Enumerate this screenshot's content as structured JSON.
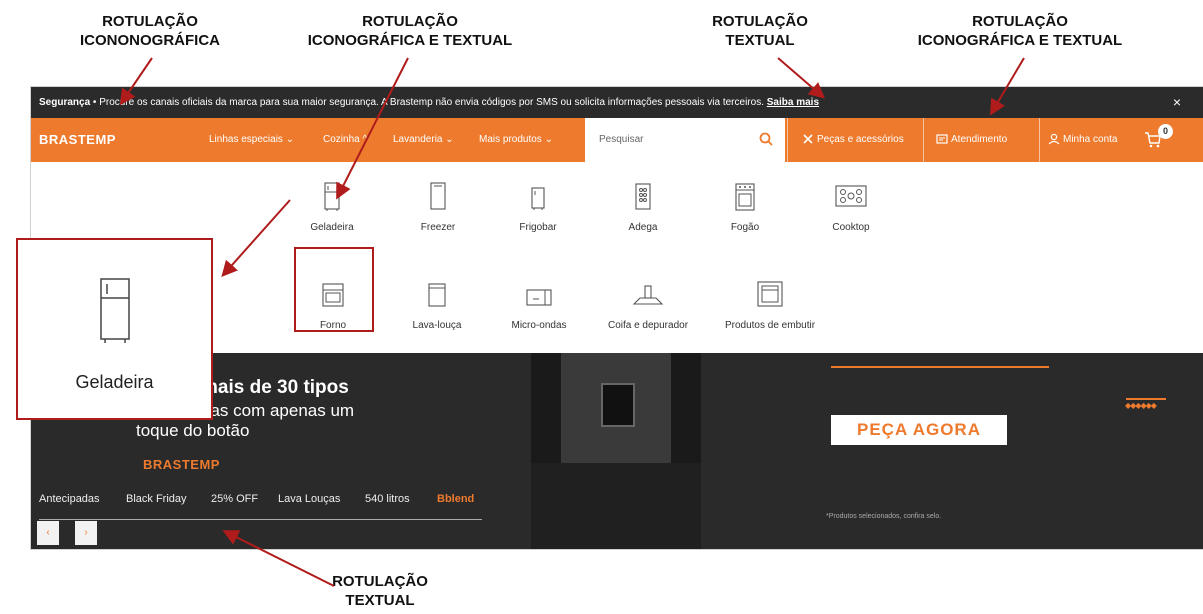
{
  "annotations": {
    "top_left": [
      "ROTULAÇÃO",
      "ICONONOGRÁFICA"
    ],
    "top_center": [
      "ROTULAÇÃO",
      "ICONOGRÁFICA E TEXTUAL"
    ],
    "top_mid_right": [
      "ROTULAÇÃO",
      "TEXTUAL"
    ],
    "top_right": [
      "ROTULAÇÃO",
      "ICONOGRÁFICA E TEXTUAL"
    ],
    "bottom": [
      "ROTULAÇÃO",
      "TEXTUAL"
    ]
  },
  "alert": {
    "bold": "Segurança",
    "message": " • Procure os canais oficiais da marca para sua maior segurança. A Brastemp não envia códigos por SMS ou solicita informações pessoais via terceiros. ",
    "link": "Saiba mais",
    "close": "×"
  },
  "nav": {
    "logo": "BRASTEMP",
    "menus": [
      "Linhas especiais ⌄",
      "Cozinha ^",
      "Lavanderia ⌄",
      "Mais produtos ⌄"
    ],
    "search_placeholder": "Pesquisar",
    "pecas": "Peças e acessórios",
    "atendimento": "Atendimento",
    "conta": "Minha conta",
    "cart_count": "0"
  },
  "dropdown": {
    "row1": [
      "Geladeira",
      "Freezer",
      "Frigobar",
      "Adega",
      "Fogão",
      "Cooktop"
    ],
    "row2": [
      "Forno",
      "Lava-louça",
      "Micro-ondas",
      "Coifa e depurador",
      "Produtos de embutir"
    ]
  },
  "zoom": {
    "label": "Geladeira"
  },
  "banner": {
    "headline": "mais de 30 tipos",
    "sub1": "das com apenas um",
    "sub2": "toque do botão",
    "brand": "BRASTEMP",
    "cta": "PEÇA AGORA",
    "fine_print": "*Produtos selecionados, confira selo.",
    "tabs": [
      "Antecipadas",
      "Black Friday",
      "25% OFF",
      "Lava Louças",
      "540 litros",
      "Bblend"
    ],
    "prev": "‹",
    "next": "›"
  },
  "colors": {
    "accent": "#ee7a2d",
    "annotation": "#b01c1c",
    "dark": "#2b2b2b"
  }
}
